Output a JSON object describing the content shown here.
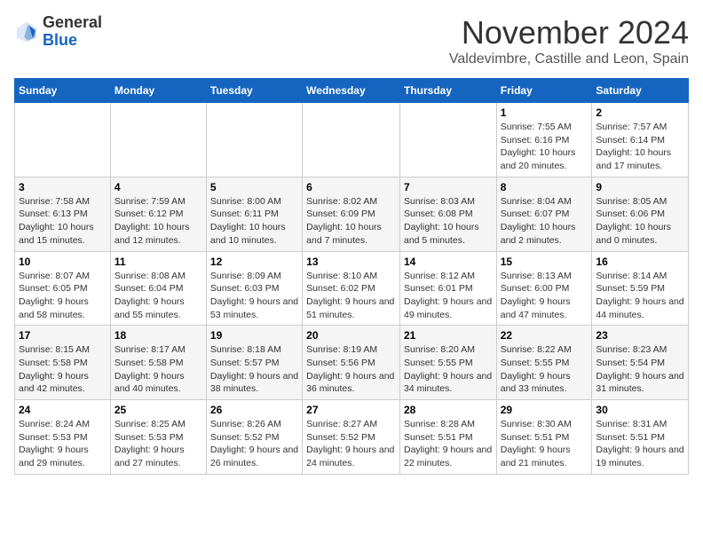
{
  "logo": {
    "general": "General",
    "blue": "Blue"
  },
  "title": "November 2024",
  "subtitle": "Valdevimbre, Castille and Leon, Spain",
  "days_of_week": [
    "Sunday",
    "Monday",
    "Tuesday",
    "Wednesday",
    "Thursday",
    "Friday",
    "Saturday"
  ],
  "weeks": [
    [
      {
        "day": null
      },
      {
        "day": null
      },
      {
        "day": null
      },
      {
        "day": null
      },
      {
        "day": null
      },
      {
        "day": "1",
        "sunrise": "Sunrise: 7:55 AM",
        "sunset": "Sunset: 6:16 PM",
        "daylight": "Daylight: 10 hours and 20 minutes."
      },
      {
        "day": "2",
        "sunrise": "Sunrise: 7:57 AM",
        "sunset": "Sunset: 6:14 PM",
        "daylight": "Daylight: 10 hours and 17 minutes."
      }
    ],
    [
      {
        "day": "3",
        "sunrise": "Sunrise: 7:58 AM",
        "sunset": "Sunset: 6:13 PM",
        "daylight": "Daylight: 10 hours and 15 minutes."
      },
      {
        "day": "4",
        "sunrise": "Sunrise: 7:59 AM",
        "sunset": "Sunset: 6:12 PM",
        "daylight": "Daylight: 10 hours and 12 minutes."
      },
      {
        "day": "5",
        "sunrise": "Sunrise: 8:00 AM",
        "sunset": "Sunset: 6:11 PM",
        "daylight": "Daylight: 10 hours and 10 minutes."
      },
      {
        "day": "6",
        "sunrise": "Sunrise: 8:02 AM",
        "sunset": "Sunset: 6:09 PM",
        "daylight": "Daylight: 10 hours and 7 minutes."
      },
      {
        "day": "7",
        "sunrise": "Sunrise: 8:03 AM",
        "sunset": "Sunset: 6:08 PM",
        "daylight": "Daylight: 10 hours and 5 minutes."
      },
      {
        "day": "8",
        "sunrise": "Sunrise: 8:04 AM",
        "sunset": "Sunset: 6:07 PM",
        "daylight": "Daylight: 10 hours and 2 minutes."
      },
      {
        "day": "9",
        "sunrise": "Sunrise: 8:05 AM",
        "sunset": "Sunset: 6:06 PM",
        "daylight": "Daylight: 10 hours and 0 minutes."
      }
    ],
    [
      {
        "day": "10",
        "sunrise": "Sunrise: 8:07 AM",
        "sunset": "Sunset: 6:05 PM",
        "daylight": "Daylight: 9 hours and 58 minutes."
      },
      {
        "day": "11",
        "sunrise": "Sunrise: 8:08 AM",
        "sunset": "Sunset: 6:04 PM",
        "daylight": "Daylight: 9 hours and 55 minutes."
      },
      {
        "day": "12",
        "sunrise": "Sunrise: 8:09 AM",
        "sunset": "Sunset: 6:03 PM",
        "daylight": "Daylight: 9 hours and 53 minutes."
      },
      {
        "day": "13",
        "sunrise": "Sunrise: 8:10 AM",
        "sunset": "Sunset: 6:02 PM",
        "daylight": "Daylight: 9 hours and 51 minutes."
      },
      {
        "day": "14",
        "sunrise": "Sunrise: 8:12 AM",
        "sunset": "Sunset: 6:01 PM",
        "daylight": "Daylight: 9 hours and 49 minutes."
      },
      {
        "day": "15",
        "sunrise": "Sunrise: 8:13 AM",
        "sunset": "Sunset: 6:00 PM",
        "daylight": "Daylight: 9 hours and 47 minutes."
      },
      {
        "day": "16",
        "sunrise": "Sunrise: 8:14 AM",
        "sunset": "Sunset: 5:59 PM",
        "daylight": "Daylight: 9 hours and 44 minutes."
      }
    ],
    [
      {
        "day": "17",
        "sunrise": "Sunrise: 8:15 AM",
        "sunset": "Sunset: 5:58 PM",
        "daylight": "Daylight: 9 hours and 42 minutes."
      },
      {
        "day": "18",
        "sunrise": "Sunrise: 8:17 AM",
        "sunset": "Sunset: 5:58 PM",
        "daylight": "Daylight: 9 hours and 40 minutes."
      },
      {
        "day": "19",
        "sunrise": "Sunrise: 8:18 AM",
        "sunset": "Sunset: 5:57 PM",
        "daylight": "Daylight: 9 hours and 38 minutes."
      },
      {
        "day": "20",
        "sunrise": "Sunrise: 8:19 AM",
        "sunset": "Sunset: 5:56 PM",
        "daylight": "Daylight: 9 hours and 36 minutes."
      },
      {
        "day": "21",
        "sunrise": "Sunrise: 8:20 AM",
        "sunset": "Sunset: 5:55 PM",
        "daylight": "Daylight: 9 hours and 34 minutes."
      },
      {
        "day": "22",
        "sunrise": "Sunrise: 8:22 AM",
        "sunset": "Sunset: 5:55 PM",
        "daylight": "Daylight: 9 hours and 33 minutes."
      },
      {
        "day": "23",
        "sunrise": "Sunrise: 8:23 AM",
        "sunset": "Sunset: 5:54 PM",
        "daylight": "Daylight: 9 hours and 31 minutes."
      }
    ],
    [
      {
        "day": "24",
        "sunrise": "Sunrise: 8:24 AM",
        "sunset": "Sunset: 5:53 PM",
        "daylight": "Daylight: 9 hours and 29 minutes."
      },
      {
        "day": "25",
        "sunrise": "Sunrise: 8:25 AM",
        "sunset": "Sunset: 5:53 PM",
        "daylight": "Daylight: 9 hours and 27 minutes."
      },
      {
        "day": "26",
        "sunrise": "Sunrise: 8:26 AM",
        "sunset": "Sunset: 5:52 PM",
        "daylight": "Daylight: 9 hours and 26 minutes."
      },
      {
        "day": "27",
        "sunrise": "Sunrise: 8:27 AM",
        "sunset": "Sunset: 5:52 PM",
        "daylight": "Daylight: 9 hours and 24 minutes."
      },
      {
        "day": "28",
        "sunrise": "Sunrise: 8:28 AM",
        "sunset": "Sunset: 5:51 PM",
        "daylight": "Daylight: 9 hours and 22 minutes."
      },
      {
        "day": "29",
        "sunrise": "Sunrise: 8:30 AM",
        "sunset": "Sunset: 5:51 PM",
        "daylight": "Daylight: 9 hours and 21 minutes."
      },
      {
        "day": "30",
        "sunrise": "Sunrise: 8:31 AM",
        "sunset": "Sunset: 5:51 PM",
        "daylight": "Daylight: 9 hours and 19 minutes."
      }
    ]
  ]
}
